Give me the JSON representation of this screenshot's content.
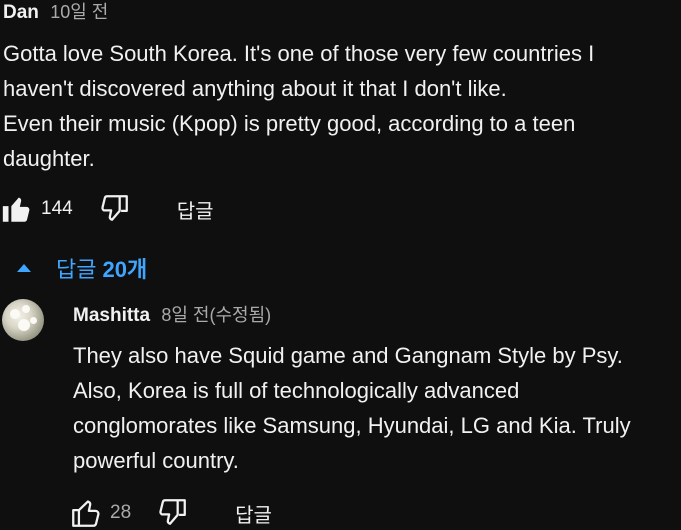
{
  "comment": {
    "author": "Dan",
    "time": "10일 전",
    "lines": [
      "Gotta love South Korea.  It's one of those very few countries I",
      "haven't discovered anything about it that I don't like.",
      "Even their music (Kpop) is pretty good, according to a teen",
      "daughter."
    ],
    "like_count": "144",
    "reply_label": "답글"
  },
  "replies_toggle": {
    "label": "답글",
    "count": "20개"
  },
  "reply": {
    "author": "Mashitta",
    "time": "8일 전(수정됨)",
    "lines": [
      "They also have Squid game and Gangnam Style by Psy.",
      "Also, Korea is full of technologically advanced",
      "conglomorates like Samsung, Hyundai, LG and Kia. Truly",
      "powerful country."
    ],
    "like_count": "28",
    "reply_label": "답글"
  },
  "colors": {
    "background": "#0f0f0f",
    "text": "#f1f1f1",
    "secondary": "#aaaaaa",
    "link": "#3ea6ff"
  }
}
